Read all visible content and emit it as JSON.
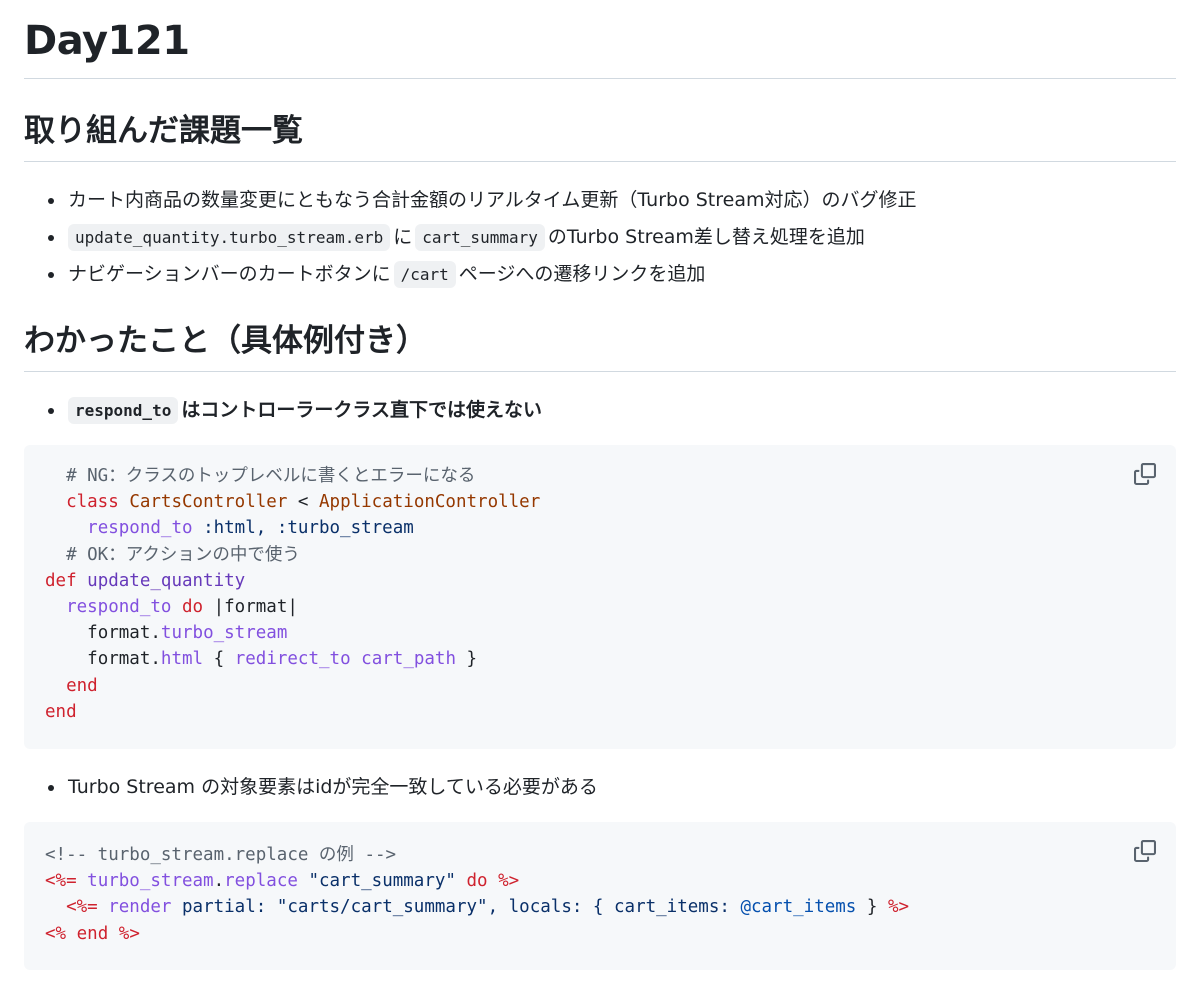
{
  "title": "Day121",
  "section1": {
    "heading": "取り組んだ課題一覧",
    "items": [
      {
        "text": "カート内商品の数量変更にともなう合計金額のリアルタイム更新（Turbo Stream対応）のバグ修正"
      },
      {
        "code1": "update_quantity.turbo_stream.erb",
        "mid": "に",
        "code2": "cart_summary",
        "tail": "のTurbo Stream差し替え処理を追加"
      },
      {
        "head": "ナビゲーションバーのカートボタンに",
        "code": "/cart",
        "tail": "ページへの遷移リンクを追加"
      }
    ]
  },
  "section2": {
    "heading": "わかったこと（具体例付き）",
    "item1": {
      "code": "respond_to",
      "text": "はコントローラークラス直下では使えない"
    },
    "code1": {
      "l1_comment": "# NG：クラスのトップレベルに書くとエラーになる",
      "l2_kw": "class",
      "l2_cls": "CartsController",
      "l2_op": "<",
      "l2_parent": "ApplicationController",
      "l3_fn": "respond_to",
      "l3_args": ":html, :turbo_stream",
      "l4_comment": "# OK：アクションの中で使う",
      "l5_kw": "def",
      "l5_fn": "update_quantity",
      "l6_fn": "respond_to",
      "l6_kw": "do",
      "l6_arg": "|format|",
      "l7_obj": "format.",
      "l7_fn": "turbo_stream",
      "l8_obj": "format.",
      "l8_fn": "html",
      "l8_open": "{",
      "l8_fn2": "redirect_to",
      "l8_fn3": "cart_path",
      "l8_close": "}",
      "l9_kw": "end",
      "l10_kw": "end"
    },
    "item2": {
      "text": "Turbo Stream の対象要素はidが完全一致している必要がある"
    },
    "code2": {
      "l1_comment": "<!-- turbo_stream.replace の例 -->",
      "l2_open": "<%=",
      "l2_fn": "turbo_stream",
      "l2_dot": ".",
      "l2_fn2": "replace",
      "l2_str": "\"cart_summary\"",
      "l2_kw": "do",
      "l2_close": "%>",
      "l3_open": "<%=",
      "l3_fn": "render",
      "l3_arg": "partial:",
      "l3_str": "\"carts/cart_summary\"",
      "l3_rest": ", locals: { cart_items:",
      "l3_ivar": "@cart_items",
      "l3_brace": "}",
      "l3_close": "%>",
      "l4_open": "<%",
      "l4_kw": "end",
      "l4_close": "%>"
    }
  },
  "icons": {
    "copy": "copy-icon"
  }
}
